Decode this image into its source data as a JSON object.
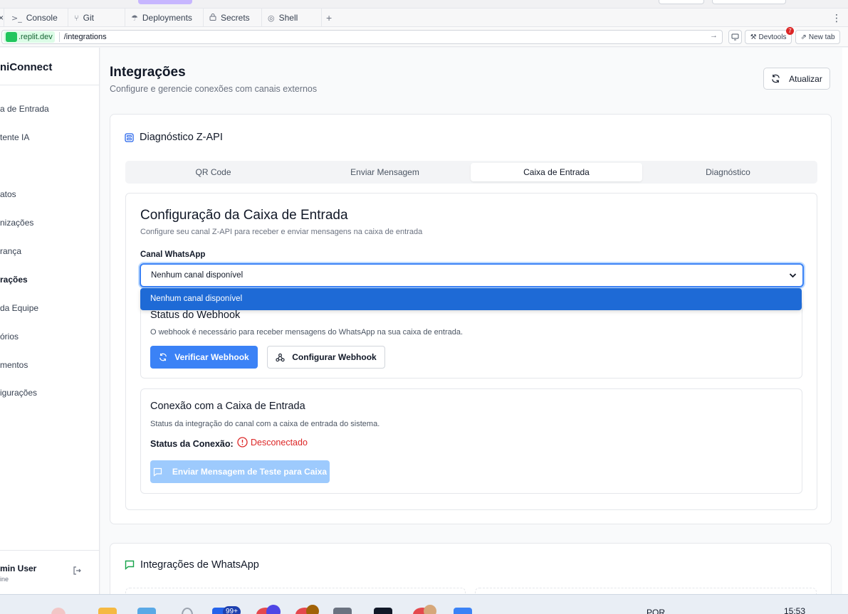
{
  "browser": {
    "tabs": [
      {
        "label": "Console",
        "icon": "terminal-icon",
        "glyph": ">_"
      },
      {
        "label": "Git",
        "icon": "git-icon",
        "glyph": "⑂"
      },
      {
        "label": "Deployments",
        "icon": "deploy-icon",
        "glyph": "☂"
      },
      {
        "label": "Secrets",
        "icon": "lock-icon",
        "glyph": "🔒"
      },
      {
        "label": "Shell",
        "icon": "shell-icon",
        "glyph": "◎"
      }
    ],
    "close_glyph": "×",
    "new_tab_glyph": "+",
    "more_glyph": "⋮",
    "domain": ".replit.dev",
    "path": "/integrations",
    "devtools_label": "Devtools",
    "devtools_badge": "7",
    "new_tab_label": "New tab"
  },
  "sidebar": {
    "brand": "niConnect",
    "items": [
      {
        "label": "a de Entrada"
      },
      {
        "label": "tente IA"
      },
      {
        "label": "atos"
      },
      {
        "label": "nizações"
      },
      {
        "label": "rança"
      },
      {
        "label": "rações",
        "active": true
      },
      {
        "label": "da Equipe"
      },
      {
        "label": "órios"
      },
      {
        "label": "mentos"
      },
      {
        "label": "igurações"
      }
    ],
    "user_name": "min User",
    "user_status": "ine"
  },
  "header": {
    "title": "Integrações",
    "subtitle": "Configure e gerencie conexões com canais externos",
    "refresh_label": "Atualizar"
  },
  "diagnostics": {
    "title": "Diagnóstico Z-API",
    "tabs": [
      "QR Code",
      "Enviar Mensagem",
      "Caixa de Entrada",
      "Diagnóstico"
    ],
    "active_tab": 2
  },
  "inbox": {
    "title": "Configuração da Caixa de Entrada",
    "subtitle": "Configure seu canal Z-API para receber e enviar mensagens na caixa de entrada",
    "channel_label": "Canal WhatsApp",
    "channel_value": "Nenhum canal disponível",
    "dropdown_option": "Nenhum canal disponível"
  },
  "webhook": {
    "title": "Status do Webhook",
    "description": "O webhook é necessário para receber mensagens do WhatsApp na sua caixa de entrada.",
    "verify_label": "Verificar Webhook",
    "configure_label": "Configurar Webhook"
  },
  "connection": {
    "title": "Conexão com a Caixa de Entrada",
    "description": "Status da integração do canal com a caixa de entrada do sistema.",
    "status_label": "Status da Conexão:",
    "status_value": "Desconectado",
    "test_label": "Enviar Mensagem de Teste para Caixa"
  },
  "whatsapp": {
    "title": "Integrações de WhatsApp"
  },
  "taskbar": {
    "badge": "99+",
    "lang": "POR",
    "time": "15:53"
  },
  "colors": {
    "primary": "#3b82f6",
    "danger": "#dc2626",
    "dropdown_highlight": "#1e6ad6",
    "whatsapp": "#16a34a"
  }
}
